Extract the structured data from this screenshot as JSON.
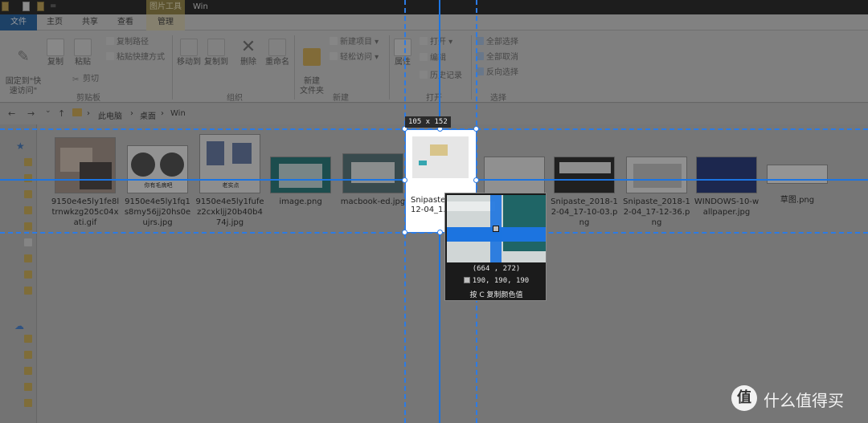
{
  "titlebar": {
    "tool_tab": "图片工具",
    "title": "Win",
    "dash": "="
  },
  "tabs": {
    "file": "文件",
    "home": "主页",
    "share": "共享",
    "view": "查看",
    "manage": "管理"
  },
  "ribbon": {
    "pin_label": "固定到\"快\n速访问\"",
    "copy": "复制",
    "paste": "粘贴",
    "copy_path": "复制路径",
    "paste_shortcut": "粘贴快捷方式",
    "cut": "剪切",
    "group_clipboard": "剪贴板",
    "move_to": "移动到",
    "copy_to": "复制到",
    "delete": "删除",
    "rename": "重命名",
    "group_organize": "组织",
    "new_folder": "新建\n文件夹",
    "new_item": "新建项目 ▾",
    "easy_access": "轻松访问 ▾",
    "group_new": "新建",
    "properties": "属性",
    "open": "打开 ▾",
    "edit": "编辑",
    "history": "历史记录",
    "group_open": "打开",
    "select_all": "全部选择",
    "select_none": "全部取消",
    "invert_selection": "反向选择",
    "group_select": "选择"
  },
  "address": {
    "back": "←",
    "forward": "→",
    "recent": "⌄",
    "up": "↑",
    "sep": "›",
    "crumbs": [
      "此电脑",
      "桌面",
      "Win"
    ]
  },
  "files": [
    {
      "name": "9150e4e5ly1fe8ltrnwkzg205c04xati.gif"
    },
    {
      "name": "9150e4e5ly1fq1s8my56jj20hs0eujrs.jpg"
    },
    {
      "name": "9150e4e5ly1fufez2cxkljj20b40b474j.jpg"
    },
    {
      "name": "image.png"
    },
    {
      "name": "macbook-ed.jpg"
    },
    {
      "name": "Snipaste_2018-12-04_1...png"
    },
    {
      "name": ""
    },
    {
      "name": "Snipaste_2018-12-04_17-10-03.png"
    },
    {
      "name": "Snipaste_2018-12-04_17-12-36.png"
    },
    {
      "name": "WINDOWS-10-wallpaper.jpg"
    },
    {
      "name": "草图.png"
    }
  ],
  "thumb_captions": {
    "meme1": "你有毛病吧",
    "meme2": "老实点"
  },
  "selection": {
    "size_label": "105 x 152"
  },
  "magnifier": {
    "coords": "(664 , 272)",
    "color": "190, 190, 190",
    "hint": "按 C 复制颜色值"
  },
  "watermark": {
    "logo": "值",
    "text": "什么值得买"
  },
  "colors": {
    "guide": "#2c7be5",
    "ribbon_file": "#1d5a9a",
    "picked": "#bebebe"
  }
}
